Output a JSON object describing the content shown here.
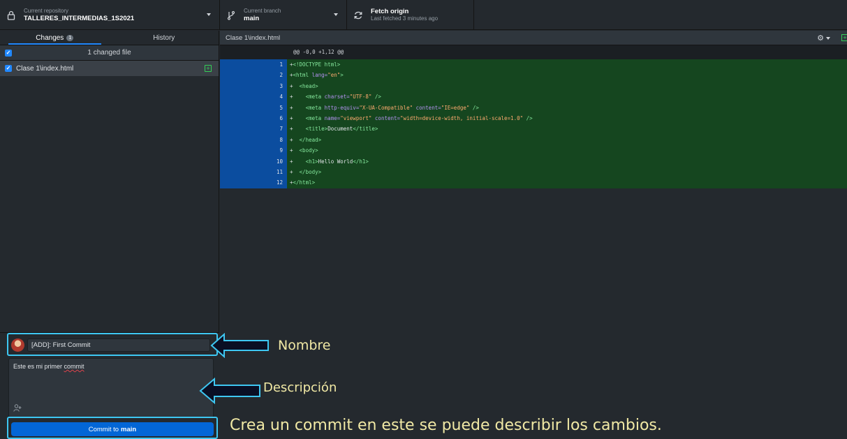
{
  "toolbar": {
    "repo_small": "Current repository",
    "repo_name": "TALLERES_INTERMEDIAS_1S2021",
    "branch_small": "Current branch",
    "branch_name": "main",
    "fetch_title": "Fetch origin",
    "fetch_sub": "Last fetched 3 minutes ago"
  },
  "sidebar": {
    "tabs": [
      {
        "label": "Changes",
        "badge": "1"
      },
      {
        "label": "History"
      }
    ],
    "changed_files_header": "1 changed file",
    "files": [
      {
        "name": "Clase 1\\index.html",
        "status": "added"
      }
    ]
  },
  "commit": {
    "summary": "[ADD]: First Commit",
    "description_before": "Este es mi primer ",
    "description_misspelled": "commit",
    "button_prefix": "Commit to",
    "button_branch": "main"
  },
  "diff": {
    "file_path": "Clase 1\\index.html",
    "hunk_header": "@@ -0,0 +1,12 @@",
    "lines": [
      {
        "num": "1",
        "segments": [
          {
            "t": "+",
            "c": ""
          },
          {
            "t": "<!DOCTYPE html>",
            "c": "tag"
          }
        ]
      },
      {
        "num": "2",
        "segments": [
          {
            "t": "+",
            "c": ""
          },
          {
            "t": "<html ",
            "c": "tag"
          },
          {
            "t": "lang=",
            "c": "attr"
          },
          {
            "t": "\"en\"",
            "c": "str"
          },
          {
            "t": ">",
            "c": "tag"
          }
        ]
      },
      {
        "num": "3",
        "segments": [
          {
            "t": "+  ",
            "c": ""
          },
          {
            "t": "<head>",
            "c": "tag"
          }
        ]
      },
      {
        "num": "4",
        "segments": [
          {
            "t": "+    ",
            "c": ""
          },
          {
            "t": "<meta ",
            "c": "tag"
          },
          {
            "t": "charset=",
            "c": "attr"
          },
          {
            "t": "\"UTF-8\"",
            "c": "str"
          },
          {
            "t": " />",
            "c": "tag"
          }
        ]
      },
      {
        "num": "5",
        "segments": [
          {
            "t": "+    ",
            "c": ""
          },
          {
            "t": "<meta ",
            "c": "tag"
          },
          {
            "t": "http-equiv=",
            "c": "attr"
          },
          {
            "t": "\"X-UA-Compatible\"",
            "c": "str"
          },
          {
            "t": " content=",
            "c": "attr"
          },
          {
            "t": "\"IE=edge\"",
            "c": "str"
          },
          {
            "t": " />",
            "c": "tag"
          }
        ]
      },
      {
        "num": "6",
        "segments": [
          {
            "t": "+    ",
            "c": ""
          },
          {
            "t": "<meta ",
            "c": "tag"
          },
          {
            "t": "name=",
            "c": "attr"
          },
          {
            "t": "\"viewport\"",
            "c": "str"
          },
          {
            "t": " content=",
            "c": "attr"
          },
          {
            "t": "\"width=device-width, initial-scale=1.0\"",
            "c": "str"
          },
          {
            "t": " />",
            "c": "tag"
          }
        ]
      },
      {
        "num": "7",
        "segments": [
          {
            "t": "+    ",
            "c": ""
          },
          {
            "t": "<title>",
            "c": "tag"
          },
          {
            "t": "Document",
            "c": ""
          },
          {
            "t": "</title>",
            "c": "tag"
          }
        ]
      },
      {
        "num": "8",
        "segments": [
          {
            "t": "+  ",
            "c": ""
          },
          {
            "t": "</head>",
            "c": "tag"
          }
        ]
      },
      {
        "num": "9",
        "segments": [
          {
            "t": "+  ",
            "c": ""
          },
          {
            "t": "<body>",
            "c": "tag"
          }
        ]
      },
      {
        "num": "10",
        "segments": [
          {
            "t": "+    ",
            "c": ""
          },
          {
            "t": "<h1>",
            "c": "tag"
          },
          {
            "t": "Hello World",
            "c": ""
          },
          {
            "t": "</h1>",
            "c": "tag"
          }
        ]
      },
      {
        "num": "11",
        "segments": [
          {
            "t": "+  ",
            "c": ""
          },
          {
            "t": "</body>",
            "c": "tag"
          }
        ]
      },
      {
        "num": "12",
        "segments": [
          {
            "t": "+",
            "c": ""
          },
          {
            "t": "</html>",
            "c": "tag"
          }
        ]
      }
    ]
  },
  "annotations": {
    "nombre": "Nombre",
    "descripcion": "Descripción",
    "crea": "Crea un commit en este se puede describir los cambios."
  },
  "colors": {
    "accent": "#0366d6",
    "annotation_text": "#f1e9a5",
    "highlight_border": "#3ec7f2",
    "added_line_bg": "#15461f",
    "gutter_bg": "#0b4d9f"
  },
  "icons": {
    "repo": "lock-icon",
    "branch": "git-branch-icon",
    "fetch": "sync-icon",
    "settings": "gear-icon",
    "file_status": "file-added-icon",
    "coauthor": "add-person-icon"
  }
}
